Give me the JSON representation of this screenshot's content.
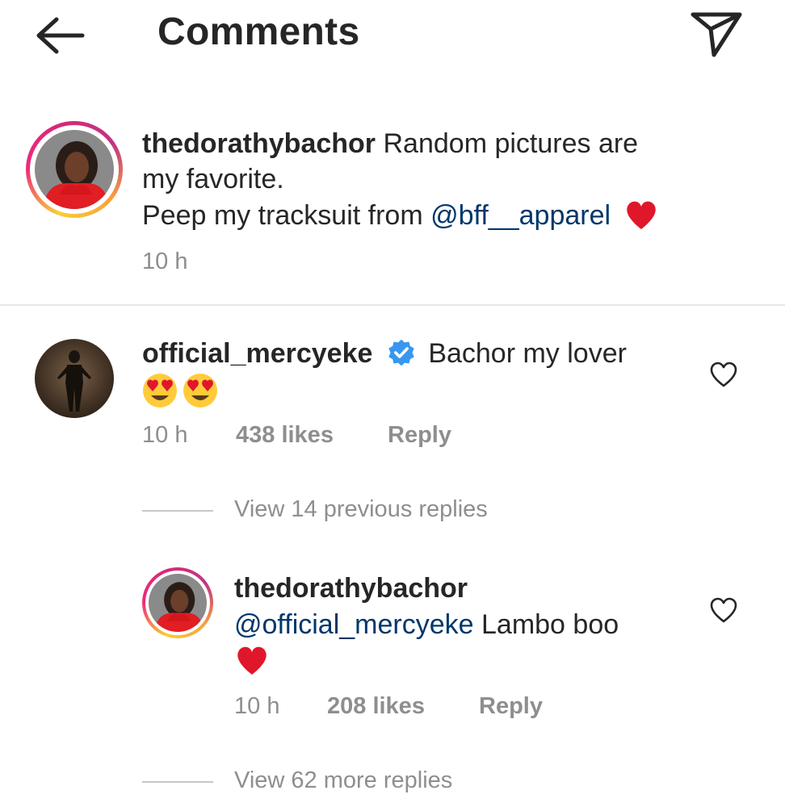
{
  "header": {
    "title": "Comments"
  },
  "caption": {
    "username": "thedorathybachor",
    "line1": "Random pictures are",
    "line2": "my favorite.",
    "line3_prefix": "Peep my tracksuit from ",
    "mention": "@bff__apparel",
    "time": "10 h"
  },
  "comments": [
    {
      "username": "official_mercyeke",
      "verified": true,
      "text": "Bachor my lover",
      "time": "10 h",
      "likes": "438 likes",
      "reply_label": "Reply",
      "view_replies": "View 14 previous replies"
    }
  ],
  "reply": {
    "username": "thedorathybachor",
    "mention": "@official_mercyeke",
    "text": " Lambo boo",
    "time": "10 h",
    "likes": "208 likes",
    "reply_label": "Reply",
    "view_more": "View 62 more replies"
  },
  "colors": {
    "text": "#262626",
    "muted": "#8e8e8e",
    "link": "#00376b",
    "verified": "#3897f0",
    "heart": "#e0172b"
  }
}
